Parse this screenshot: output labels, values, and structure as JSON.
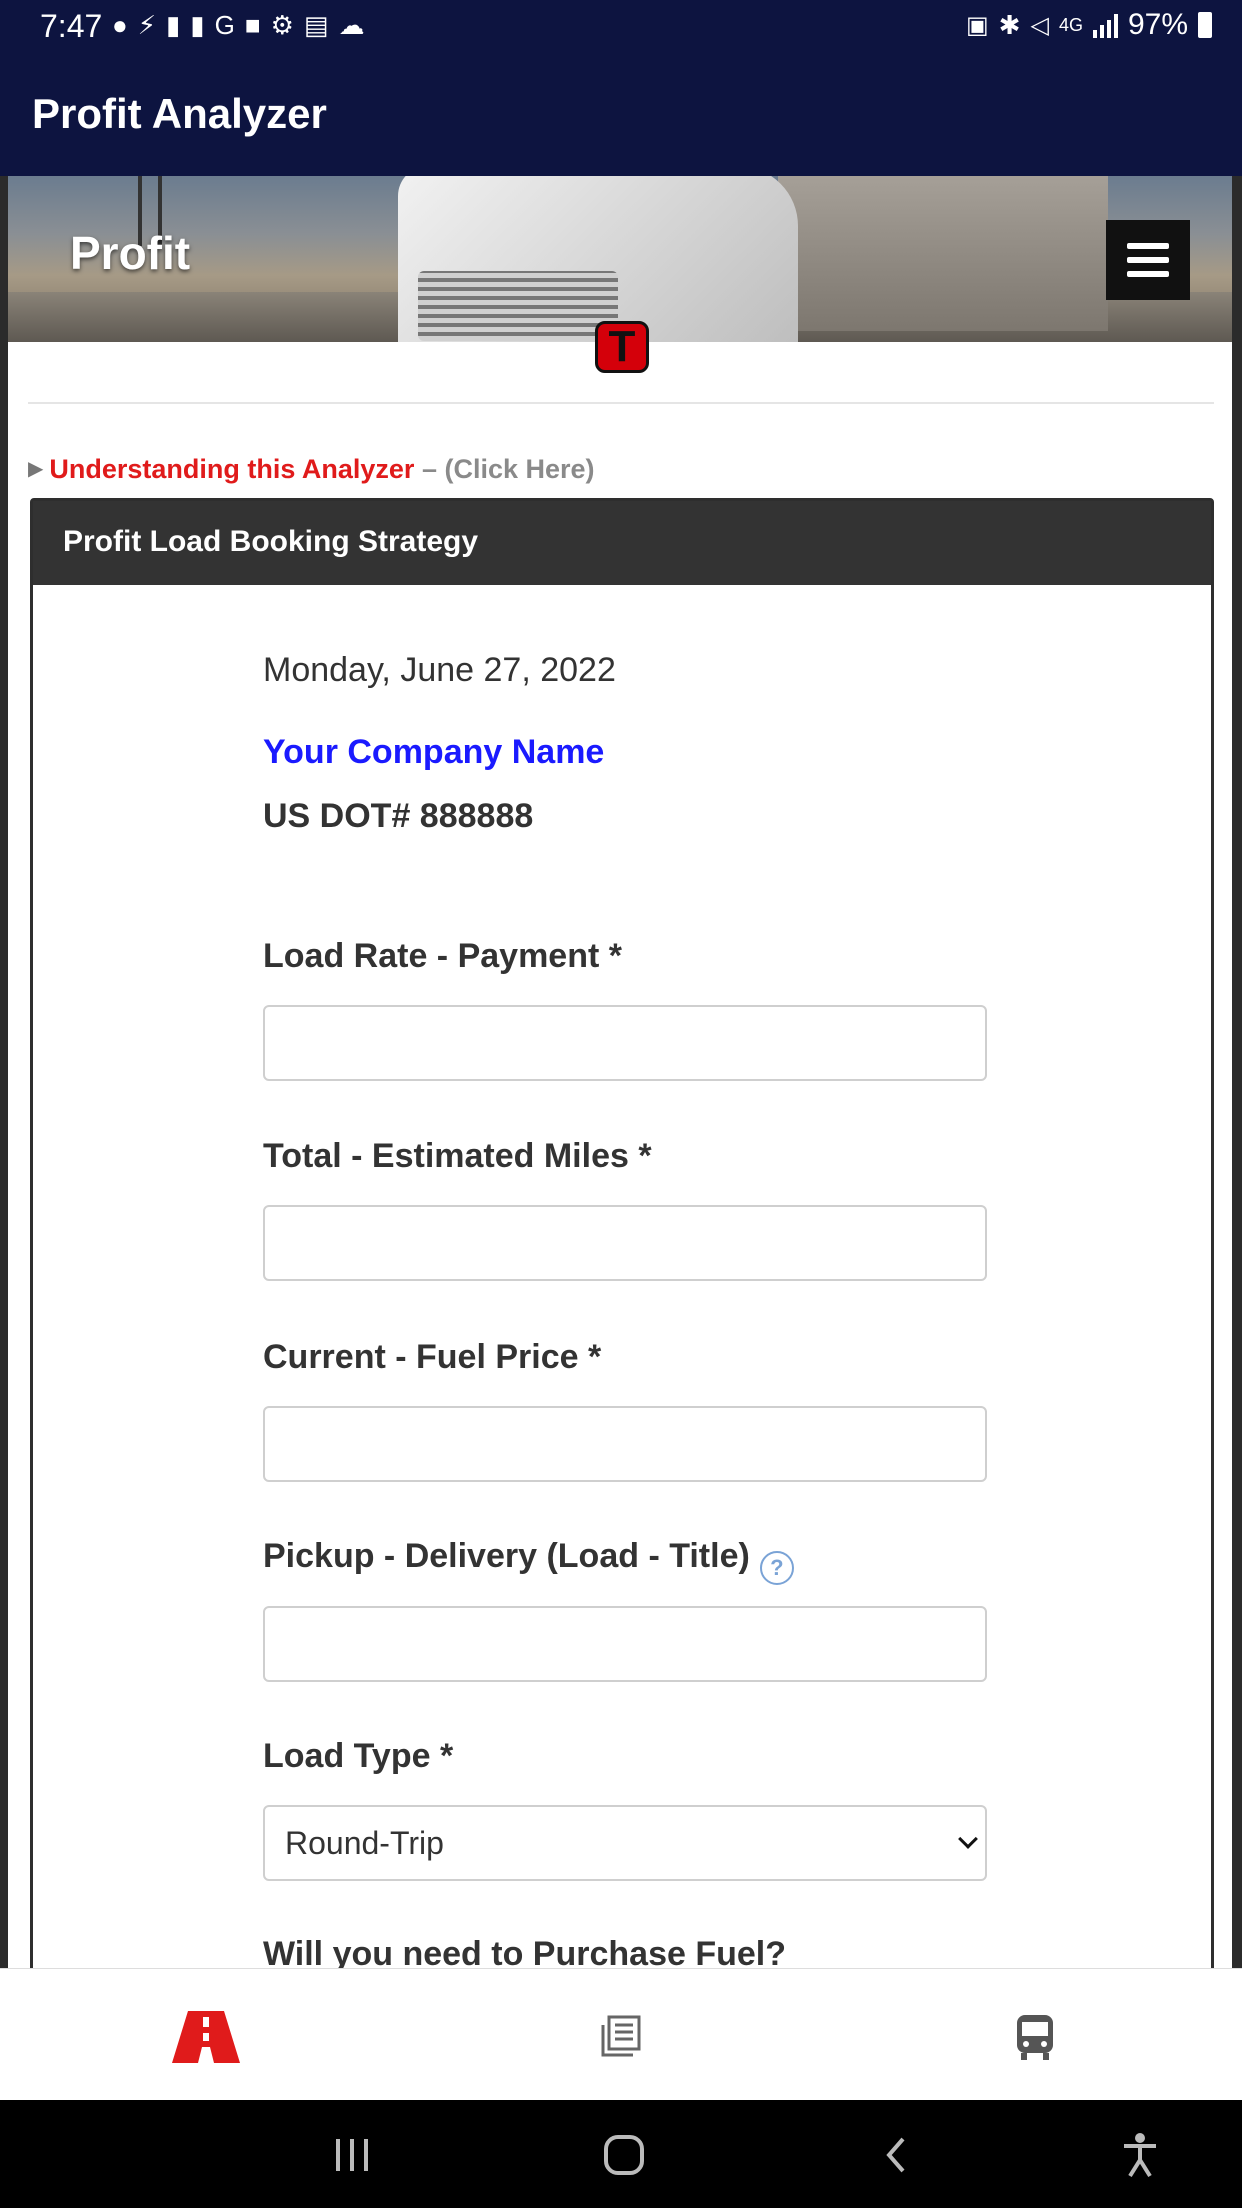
{
  "status_bar": {
    "time": "7:47",
    "battery": "97%"
  },
  "app_bar": {
    "title": "Profit Analyzer"
  },
  "hero": {
    "title": "Profit",
    "logo_letter": "T"
  },
  "understanding": {
    "link": "Understanding this Analyzer",
    "separator": " – ",
    "hint": "(Click Here)"
  },
  "card": {
    "header": "Profit Load Booking Strategy",
    "date": "Monday, June 27, 2022",
    "company_name": "Your Company Name",
    "dot_number": "US DOT# 888888"
  },
  "form": {
    "load_rate_label": "Load Rate - Payment  *",
    "total_miles_label": "Total - Estimated Miles  *",
    "fuel_price_label": "Current - Fuel Price  *",
    "pickup_delivery_label": "Pickup - Delivery (Load - Title)",
    "help_glyph": "?",
    "load_type_label": "Load Type  *",
    "load_type_value": "Round-Trip",
    "purchase_fuel_label": "Will you need to Purchase Fuel?"
  },
  "colors": {
    "app_bar": "#0d1440",
    "link_red": "#e01b1b",
    "company_blue": "#1a1aff",
    "card_header": "#333333"
  },
  "icons": {
    "nav_home": "road-icon",
    "nav_articles": "articles-icon",
    "nav_bus": "bus-icon"
  }
}
